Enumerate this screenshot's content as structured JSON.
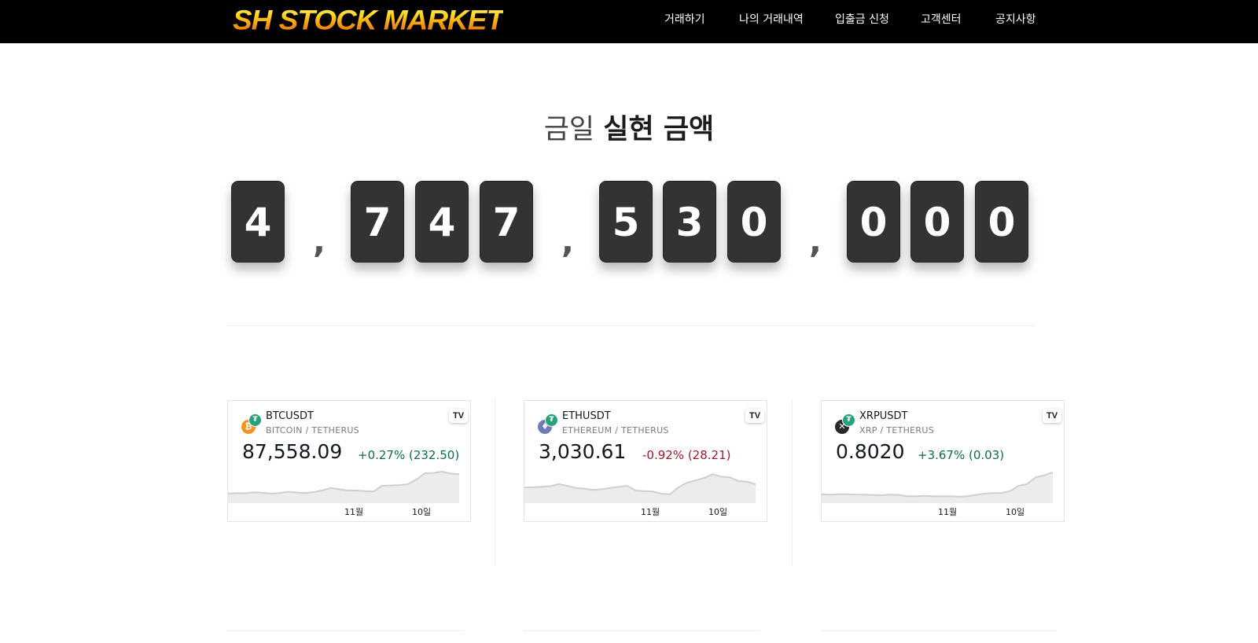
{
  "header": {
    "logo": "SH STOCK MARKET",
    "nav": [
      "거래하기",
      "나의 거래내역",
      "입출금 신청",
      "고객센터",
      "공지사항"
    ]
  },
  "hero": {
    "title_light": "금일",
    "title_bold": "실현 금액",
    "amount": "4,747,530,000",
    "digits": [
      "4",
      ",",
      "7",
      "4",
      "7",
      ",",
      "5",
      "3",
      "0",
      ",",
      "0",
      "0",
      "0"
    ]
  },
  "tickers": [
    {
      "symbol": "BTCUSDT",
      "pair": "BITCOIN / TETHERUS",
      "price": "87,558.09",
      "change": "+0.27% (232.50)",
      "direction": "up",
      "coin_icon": "bitcoin-icon",
      "coin_color": "#f7931a",
      "axis_labels": [
        "11월",
        "10일"
      ],
      "spark": [
        0.2,
        0.22,
        0.21,
        0.24,
        0.23,
        0.2,
        0.22,
        0.26,
        0.24,
        0.22,
        0.25,
        0.3,
        0.38,
        0.34,
        0.3,
        0.3,
        0.28,
        0.27,
        0.45,
        0.46,
        0.47,
        0.5,
        0.65,
        0.85,
        0.86,
        0.9,
        0.84,
        0.82
      ]
    },
    {
      "symbol": "ETHUSDT",
      "pair": "ETHEREUM / TETHERUS",
      "price": "3,030.61",
      "change": "-0.92% (28.21)",
      "direction": "down",
      "coin_icon": "ethereum-icon",
      "coin_color": "#6f7cba",
      "axis_labels": [
        "11월",
        "10일"
      ],
      "spark": [
        0.4,
        0.4,
        0.42,
        0.44,
        0.5,
        0.45,
        0.38,
        0.36,
        0.32,
        0.34,
        0.38,
        0.42,
        0.45,
        0.3,
        0.28,
        0.27,
        0.2,
        0.18,
        0.4,
        0.55,
        0.62,
        0.7,
        0.82,
        0.74,
        0.72,
        0.6,
        0.58,
        0.5
      ]
    },
    {
      "symbol": "XRPUSDT",
      "pair": "XRP / TETHERUS",
      "price": "0.8020",
      "change": "+3.67% (0.03)",
      "direction": "up",
      "coin_icon": "xrp-icon",
      "coin_color": "#23292f",
      "axis_labels": [
        "11월",
        "10일"
      ],
      "spark": [
        0.18,
        0.17,
        0.18,
        0.18,
        0.17,
        0.17,
        0.16,
        0.15,
        0.17,
        0.16,
        0.12,
        0.12,
        0.13,
        0.12,
        0.12,
        0.12,
        0.1,
        0.12,
        0.16,
        0.2,
        0.22,
        0.22,
        0.28,
        0.45,
        0.5,
        0.72,
        0.78,
        0.88
      ]
    }
  ],
  "colors": {
    "header_bg": "#000000",
    "digit_bg": "#333333",
    "up": "#0e6b56",
    "down": "#a3182a"
  }
}
